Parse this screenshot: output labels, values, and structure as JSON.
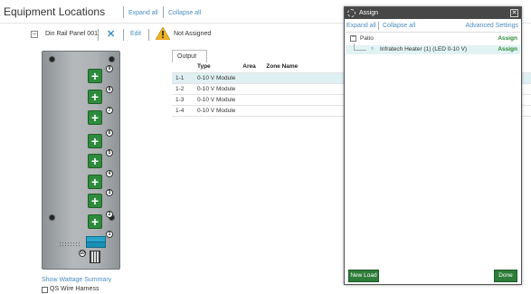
{
  "header": {
    "title": "Equipment Locations",
    "expand_all": "Expand all",
    "collapse_all": "Collapse all"
  },
  "panel": {
    "collapse_symbol": "−",
    "name": "Din Rail Panel 001",
    "remove_symbol": "✕",
    "edit_label": "Edit",
    "status": "Not Assigned",
    "slot_numbers": [
      "9",
      "8",
      "7",
      "6",
      "5",
      "4",
      "3",
      "2",
      "1"
    ],
    "terminal_number": "10",
    "show_wattage": "Show Wattage Summary",
    "wire_harness_label": "QS Wire Harness",
    "wire_harness_checked": false
  },
  "output_tab": {
    "label": "Output",
    "columns": [
      "",
      "Type",
      "Area",
      "Zone Name",
      ""
    ],
    "rows": [
      {
        "id": "1-1",
        "type": "0-10 V Module",
        "area": "",
        "zone": "",
        "selected": true
      },
      {
        "id": "1-2",
        "type": "0-10 V Module",
        "area": "",
        "zone": "",
        "selected": false
      },
      {
        "id": "1-3",
        "type": "0-10 V Module",
        "area": "",
        "zone": "",
        "selected": false
      },
      {
        "id": "1-4",
        "type": "0-10 V Module",
        "area": "",
        "zone": "",
        "selected": false
      }
    ]
  },
  "dialog": {
    "title": "Assign",
    "close_symbol": "✕",
    "expand_all": "Expand all",
    "collapse_all": "Collapse all",
    "advanced_settings": "Advanced Settings",
    "tree": [
      {
        "label": "Patio",
        "action": "Assign",
        "level": 0,
        "collapse_symbol": "−"
      },
      {
        "label": "Infratech Heater (1) (LED 0-10 V)",
        "action": "Assign",
        "level": 1,
        "icon": "lamp-icon"
      }
    ],
    "new_load": "New Load",
    "done": "Done"
  },
  "colors": {
    "link": "#4a8dbf",
    "add_button": "#2e8b3d",
    "assign": "#2a8a3a",
    "dialog_header": "#474747",
    "selection": "#dff0f2"
  }
}
